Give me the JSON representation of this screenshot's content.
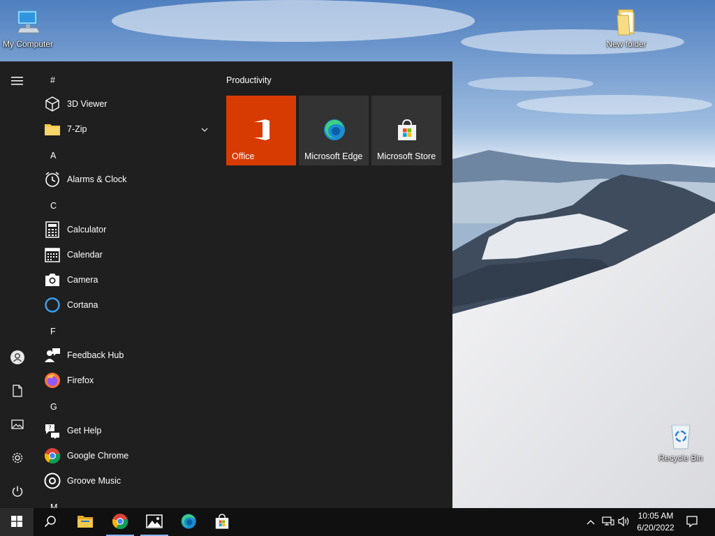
{
  "desktop": {
    "icons": [
      {
        "label": "My Computer",
        "icon": "computer-icon"
      },
      {
        "label": "New folder",
        "icon": "folder-icon"
      },
      {
        "label": "Recycle Bin",
        "icon": "recycle-bin-icon"
      }
    ]
  },
  "start_menu": {
    "rail": [
      "hamburger-icon",
      "user-icon",
      "documents-icon",
      "pictures-icon",
      "settings-icon",
      "power-icon"
    ],
    "app_list": [
      {
        "type": "letter",
        "text": "#"
      },
      {
        "type": "app",
        "label": "3D Viewer",
        "icon": "cube-icon"
      },
      {
        "type": "app",
        "label": "7-Zip",
        "icon": "folder-icon",
        "expandable": true
      },
      {
        "type": "letter",
        "text": "A"
      },
      {
        "type": "app",
        "label": "Alarms & Clock",
        "icon": "alarm-clock-icon"
      },
      {
        "type": "letter",
        "text": "C"
      },
      {
        "type": "app",
        "label": "Calculator",
        "icon": "calculator-icon"
      },
      {
        "type": "app",
        "label": "Calendar",
        "icon": "calendar-icon"
      },
      {
        "type": "app",
        "label": "Camera",
        "icon": "camera-icon"
      },
      {
        "type": "app",
        "label": "Cortana",
        "icon": "cortana-icon"
      },
      {
        "type": "letter",
        "text": "F"
      },
      {
        "type": "app",
        "label": "Feedback Hub",
        "icon": "feedback-icon"
      },
      {
        "type": "app",
        "label": "Firefox",
        "icon": "firefox-icon"
      },
      {
        "type": "letter",
        "text": "G"
      },
      {
        "type": "app",
        "label": "Get Help",
        "icon": "get-help-icon"
      },
      {
        "type": "app",
        "label": "Google Chrome",
        "icon": "chrome-icon"
      },
      {
        "type": "app",
        "label": "Groove Music",
        "icon": "groove-music-icon"
      },
      {
        "type": "letter",
        "text": "M"
      }
    ],
    "group_title": "Productivity",
    "tiles": [
      {
        "label": "Office",
        "icon": "office-icon",
        "color": "#d83b01"
      },
      {
        "label": "Microsoft Edge",
        "icon": "edge-icon",
        "color": "#333333"
      },
      {
        "label": "Microsoft Store",
        "icon": "store-icon",
        "color": "#333333"
      }
    ]
  },
  "taskbar": {
    "pinned": [
      "start-icon",
      "search-icon",
      "file-explorer-icon",
      "chrome-icon",
      "photos-icon",
      "edge-icon",
      "store-icon"
    ],
    "tray_icons": [
      "chevron-up-icon",
      "network-icon",
      "volume-icon",
      "notification-icon"
    ],
    "clock": {
      "time": "10:05 AM",
      "date": "6/20/2022"
    }
  }
}
